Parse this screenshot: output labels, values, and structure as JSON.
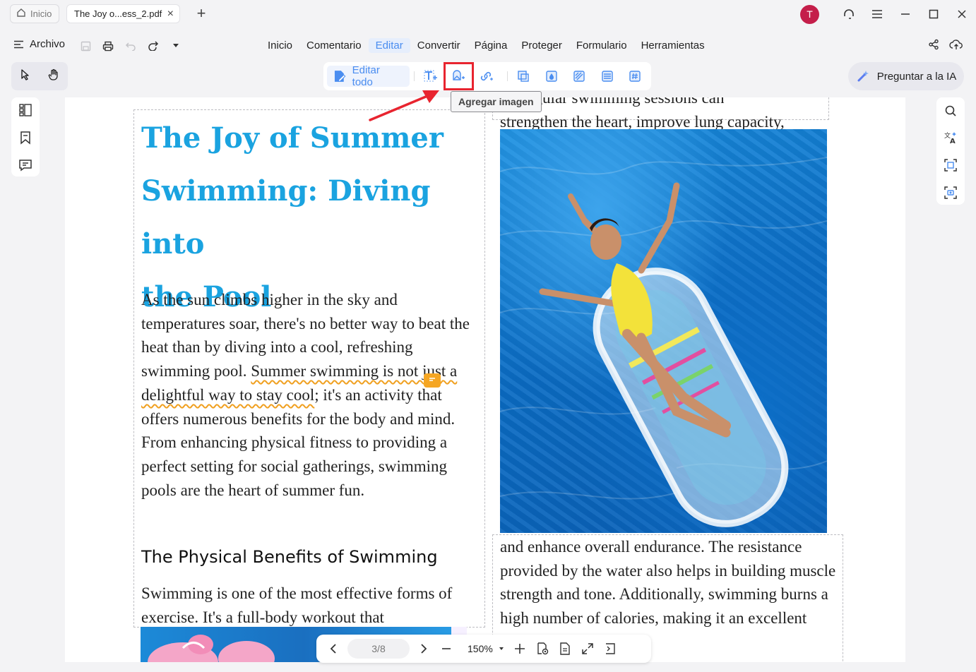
{
  "tabs": {
    "home_label": "Inicio",
    "doc_label": "The Joy o...ess_2.pdf"
  },
  "user": {
    "avatar_initial": "T"
  },
  "menu": {
    "archivo": "Archivo",
    "items": [
      "Inicio",
      "Comentario",
      "Editar",
      "Convertir",
      "Página",
      "Proteger",
      "Formulario",
      "Herramientas"
    ],
    "active": "Editar"
  },
  "toolbar": {
    "edit_all": "Editar todo",
    "ask_ai": "Preguntar a la IA",
    "tooltip": "Agregar imagen"
  },
  "document": {
    "title_lines": [
      "The Joy of Summer",
      "Swimming: Diving into",
      "the Pool"
    ],
    "top_right_partial": "... Regular swimming sessions can",
    "top_right_line": "strengthen the heart, improve lung capacity,",
    "para1_a": "As the sun climbs higher in the sky and temperatures soar, there's no better way to beat the heat than by diving into a cool, refreshing swimming pool. ",
    "para1_squig": "Summer swimming is not just a delightful way to stay cool",
    "para1_b": "; it's an activity that offers numerous benefits for the body and mind. From enhancing physical fitness to providing a perfect setting for social gatherings, swimming pools are the heart of summer fun.",
    "heading2": "The Physical Benefits of Swimming",
    "para2": "Swimming is one of the most effective forms of exercise. It's a full-body workout that",
    "para3": "and enhance overall endurance. The resistance provided by the water also helps in building muscle strength and tone. Additionally, swimming burns a high number of calories, making it an excellent exercise for"
  },
  "nav": {
    "page": "3/8",
    "zoom": "150%"
  },
  "colors": {
    "accent": "#4a8df0",
    "title": "#1aa3e0",
    "highlight": "#e8242f",
    "avatar": "#c41e4a"
  }
}
